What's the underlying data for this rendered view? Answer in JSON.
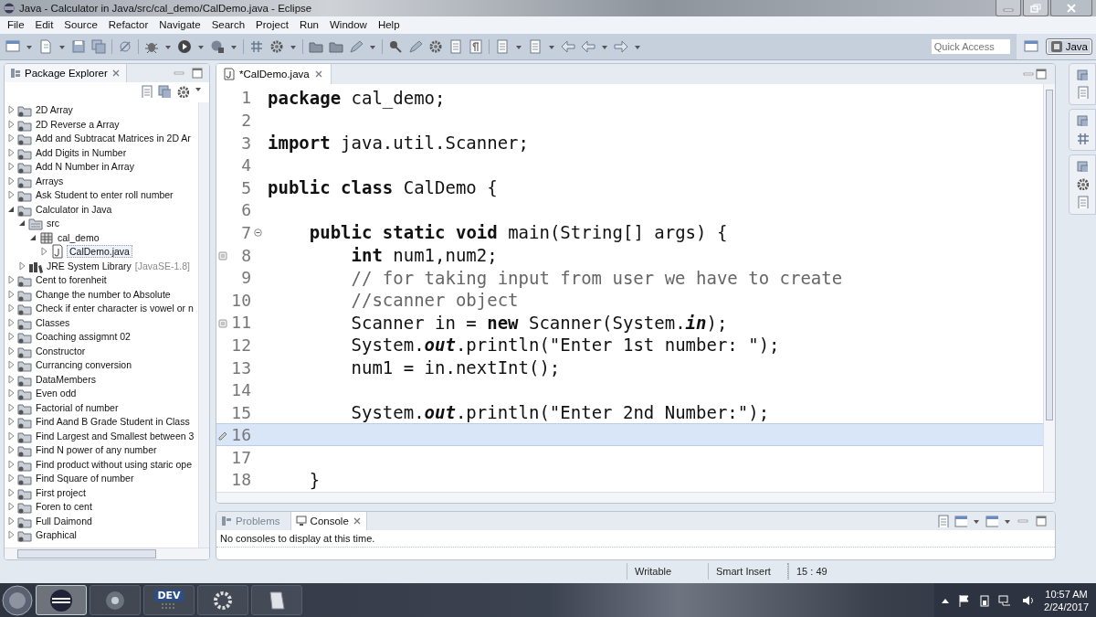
{
  "window": {
    "title": "Java - Calculator in Java/src/cal_demo/CalDemo.java - Eclipse"
  },
  "menu": [
    "File",
    "Edit",
    "Source",
    "Refactor",
    "Navigate",
    "Search",
    "Project",
    "Run",
    "Window",
    "Help"
  ],
  "toolbar": {
    "quick_access": {
      "placeholder": "Quick Access"
    },
    "perspectives": [
      {
        "label": "Java",
        "selected": true
      }
    ]
  },
  "explorer": {
    "title": "Package Explorer",
    "tree": [
      {
        "label": "2D Array",
        "kind": "project",
        "expanded": false,
        "selected": false
      },
      {
        "label": "2D Reverse a Array",
        "kind": "project",
        "expanded": false,
        "selected": false
      },
      {
        "label": "Add  and Subtracat Matrices in 2D Ar",
        "kind": "project",
        "expanded": false,
        "selected": false
      },
      {
        "label": "Add Digits in Number",
        "kind": "project",
        "expanded": false,
        "selected": false
      },
      {
        "label": "Add N Number in Array",
        "kind": "project",
        "expanded": false,
        "selected": false
      },
      {
        "label": "Arrays",
        "kind": "project",
        "expanded": false,
        "selected": false
      },
      {
        "label": "Ask Student to enter roll number",
        "kind": "project",
        "expanded": false,
        "selected": false
      },
      {
        "label": "Calculator in Java",
        "kind": "project",
        "expanded": true,
        "selected": false,
        "children": [
          {
            "label": "src",
            "kind": "folder",
            "expanded": true,
            "selected": false,
            "children": [
              {
                "label": "cal_demo",
                "kind": "package",
                "expanded": true,
                "selected": false,
                "children": [
                  {
                    "label": "CalDemo.java",
                    "kind": "file",
                    "expanded": false,
                    "selected": true
                  }
                ]
              }
            ]
          },
          {
            "label": "JRE System Library",
            "decoration": "[JavaSE-1.8]",
            "kind": "library",
            "expanded": false,
            "selected": false
          }
        ]
      },
      {
        "label": "Cent to forenheit",
        "kind": "project",
        "expanded": false,
        "selected": false
      },
      {
        "label": "Change the number to Absolute",
        "kind": "project",
        "expanded": false,
        "selected": false
      },
      {
        "label": "Check if enter character is vowel or n",
        "kind": "project",
        "expanded": false,
        "selected": false
      },
      {
        "label": "Classes",
        "kind": "project",
        "expanded": false,
        "selected": false
      },
      {
        "label": "Coaching assigmnt 02",
        "kind": "project",
        "expanded": false,
        "selected": false
      },
      {
        "label": "Constructor",
        "kind": "project",
        "expanded": false,
        "selected": false
      },
      {
        "label": "Currancing conversion",
        "kind": "project",
        "expanded": false,
        "selected": false
      },
      {
        "label": "DataMembers",
        "kind": "project",
        "expanded": false,
        "selected": false
      },
      {
        "label": "Even odd",
        "kind": "project",
        "expanded": false,
        "selected": false
      },
      {
        "label": "Factorial of number",
        "kind": "project",
        "expanded": false,
        "selected": false
      },
      {
        "label": "Find Aand B Grade Student in Class",
        "kind": "project",
        "expanded": false,
        "selected": false
      },
      {
        "label": "Find Largest and Smallest between 3",
        "kind": "project",
        "expanded": false,
        "selected": false
      },
      {
        "label": "Find N power of any number",
        "kind": "project",
        "expanded": false,
        "selected": false
      },
      {
        "label": "Find product without using staric ope",
        "kind": "project",
        "expanded": false,
        "selected": false
      },
      {
        "label": "Find Square of number",
        "kind": "project",
        "expanded": false,
        "selected": false
      },
      {
        "label": "First project",
        "kind": "project",
        "expanded": false,
        "selected": false
      },
      {
        "label": "Foren to cent",
        "kind": "project",
        "expanded": false,
        "selected": false
      },
      {
        "label": "Full Daimond",
        "kind": "project",
        "expanded": false,
        "selected": false
      },
      {
        "label": "Graphical",
        "kind": "project",
        "expanded": false,
        "selected": false
      }
    ]
  },
  "editor": {
    "tab": {
      "label": "*CalDemo.java"
    },
    "lines": [
      {
        "number": "1",
        "kind": "code",
        "text": "**package** cal_demo;",
        "current": false,
        "fold": false,
        "warning": false,
        "changed": false
      },
      {
        "number": "2",
        "kind": "blank",
        "current": false,
        "fold": false,
        "warning": false,
        "changed": false
      },
      {
        "number": "3",
        "kind": "code",
        "text": "**import** java.util.Scanner;",
        "current": false,
        "fold": false,
        "warning": false,
        "changed": false
      },
      {
        "number": "4",
        "kind": "blank",
        "current": false,
        "fold": false,
        "warning": false,
        "changed": false
      },
      {
        "number": "5",
        "kind": "code",
        "text": "**public** **class** CalDemo {",
        "current": false,
        "fold": false,
        "warning": false,
        "changed": false
      },
      {
        "number": "6",
        "kind": "blank",
        "current": false,
        "fold": false,
        "warning": false,
        "changed": false
      },
      {
        "number": "7",
        "kind": "code",
        "text": "    **public** **static** **void** main(String[] args) {",
        "current": false,
        "fold": true,
        "warning": false,
        "changed": false
      },
      {
        "number": "8",
        "kind": "code",
        "text": "        **int** num1,num2;",
        "current": false,
        "fold": false,
        "warning": true,
        "changed": false
      },
      {
        "number": "9",
        "kind": "comment",
        "text": "        // for taking input from user we have to create",
        "current": false,
        "fold": false,
        "warning": false,
        "changed": false
      },
      {
        "number": "10",
        "kind": "comment",
        "text": "        //scanner object",
        "current": false,
        "fold": false,
        "warning": false,
        "changed": false
      },
      {
        "number": "11",
        "kind": "code",
        "text": "        Scanner in = **new** Scanner(System.*in*);",
        "current": false,
        "fold": false,
        "warning": true,
        "changed": false
      },
      {
        "number": "12",
        "kind": "code",
        "text": "        System.*out*.println(\"Enter 1st number: \");",
        "current": false,
        "fold": false,
        "warning": false,
        "changed": false
      },
      {
        "number": "13",
        "kind": "code",
        "text": "        num1 = in.nextInt();",
        "current": false,
        "fold": false,
        "warning": false,
        "changed": false
      },
      {
        "number": "14",
        "kind": "blank",
        "current": false,
        "fold": false,
        "warning": false,
        "changed": false
      },
      {
        "number": "15",
        "kind": "code",
        "text": "        System.*out*.println(\"Enter 2nd Number:\");",
        "current": false,
        "fold": false,
        "warning": false,
        "changed": false
      },
      {
        "number": "16",
        "kind": "blank",
        "current": true,
        "fold": false,
        "warning": false,
        "changed": true
      },
      {
        "number": "17",
        "kind": "blank",
        "current": false,
        "fold": false,
        "warning": false,
        "changed": false
      },
      {
        "number": "18",
        "kind": "code",
        "text": "    }",
        "current": false,
        "fold": false,
        "warning": false,
        "changed": false
      }
    ]
  },
  "console": {
    "tabs": [
      {
        "label": "Problems",
        "selected": false
      },
      {
        "label": "Console",
        "selected": true
      }
    ],
    "message": "No consoles to display at this time."
  },
  "status_bar": [
    "Writable",
    "Smart Insert",
    "15 : 49"
  ],
  "taskbar": {
    "apps": [
      {
        "kind": "eclipse",
        "selected": true
      },
      {
        "kind": "chrome",
        "selected": false
      },
      {
        "kind": "devcpp",
        "label": "DEV",
        "selected": false
      },
      {
        "kind": "camera",
        "selected": false
      },
      {
        "kind": "notepad",
        "selected": false
      }
    ],
    "time": "10:57 AM",
    "date": "2/24/2017"
  }
}
